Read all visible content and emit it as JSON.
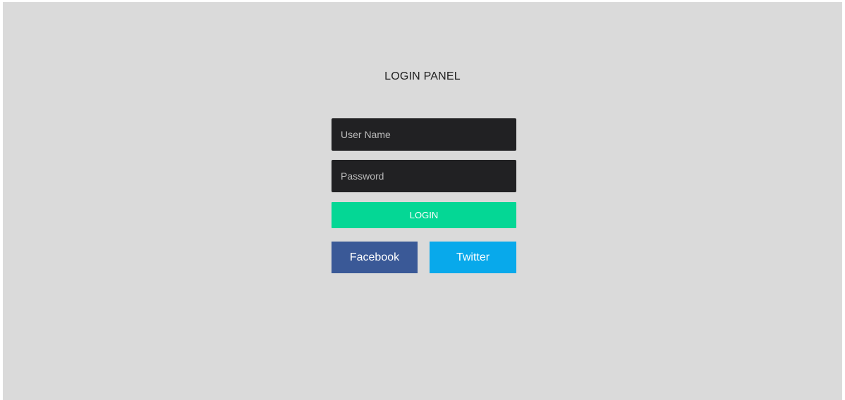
{
  "panel": {
    "title": "LOGIN PANEL",
    "username": {
      "placeholder": "User Name",
      "value": ""
    },
    "password": {
      "placeholder": "Password",
      "value": ""
    },
    "login_label": "LOGIN",
    "social": {
      "facebook_label": "Facebook",
      "twitter_label": "Twitter"
    }
  },
  "colors": {
    "background": "#dadada",
    "input_background": "#212123",
    "login_button": "#04d795",
    "facebook": "#3a5997",
    "twitter": "#08a9eb"
  }
}
